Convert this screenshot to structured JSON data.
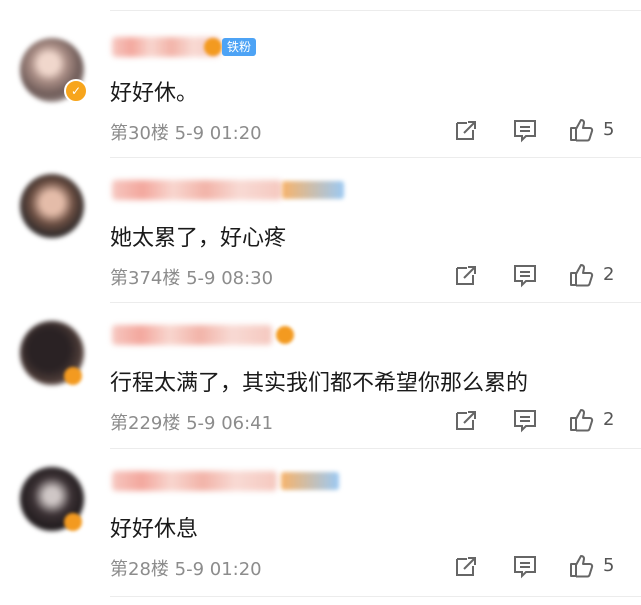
{
  "comments": [
    {
      "fan_label": "铁粉",
      "text": "好好休。",
      "floor": "第30楼",
      "time": "5-9 01:20",
      "likes": "5",
      "verified_badge": "✓"
    },
    {
      "fan_label": "",
      "text": "她太累了，好心疼",
      "floor": "第374楼",
      "time": "5-9 08:30",
      "likes": "2",
      "verified_badge": ""
    },
    {
      "fan_label": "",
      "text": "行程太满了，其实我们都不希望你那么累的",
      "floor": "第229楼",
      "time": "5-9 06:41",
      "likes": "2",
      "verified_badge": ""
    },
    {
      "fan_label": "",
      "text": "好好休息",
      "floor": "第28楼",
      "time": "5-9 01:20",
      "likes": "5",
      "verified_badge": ""
    }
  ],
  "icons": {
    "share": "share-edit-icon",
    "reply": "comment-icon",
    "like": "thumbs-up-icon"
  },
  "colors": {
    "fan_badge": "#4da3f5",
    "verified": "#f7a51c",
    "meta_text": "#8c8c8c"
  }
}
